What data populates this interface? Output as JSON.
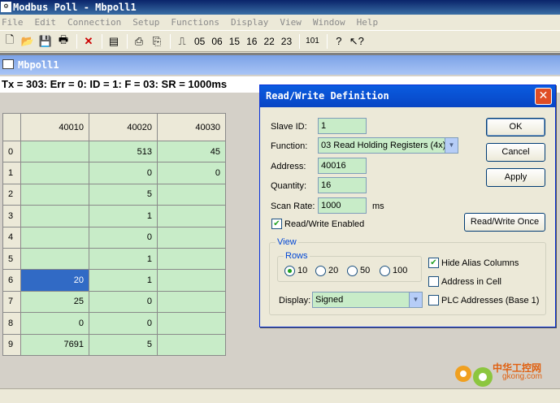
{
  "app": {
    "title": "Modbus Poll - Mbpoll1",
    "menu": [
      "File",
      "Edit",
      "Connection",
      "Setup",
      "Functions",
      "Display",
      "View",
      "Window",
      "Help"
    ],
    "toolbar_numbers": [
      "05",
      "06",
      "15",
      "16",
      "22",
      "23",
      "101"
    ]
  },
  "child": {
    "title": "Mbpoll1",
    "status": "Tx = 303: Err = 0: ID = 1: F = 03: SR = 1000ms"
  },
  "grid": {
    "columns": [
      "40010",
      "40020",
      "40030"
    ],
    "rows": [
      {
        "idx": "0",
        "c1": "",
        "c2": "513",
        "c3": "45"
      },
      {
        "idx": "1",
        "c1": "",
        "c2": "0",
        "c3": "0"
      },
      {
        "idx": "2",
        "c1": "",
        "c2": "5",
        "c3": ""
      },
      {
        "idx": "3",
        "c1": "",
        "c2": "1",
        "c3": ""
      },
      {
        "idx": "4",
        "c1": "",
        "c2": "0",
        "c3": ""
      },
      {
        "idx": "5",
        "c1": "",
        "c2": "1",
        "c3": ""
      },
      {
        "idx": "6",
        "c1": "20",
        "c2": "1",
        "c3": ""
      },
      {
        "idx": "7",
        "c1": "25",
        "c2": "0",
        "c3": ""
      },
      {
        "idx": "8",
        "c1": "0",
        "c2": "0",
        "c3": ""
      },
      {
        "idx": "9",
        "c1": "7691",
        "c2": "5",
        "c3": ""
      }
    ]
  },
  "dialog": {
    "title": "Read/Write Definition",
    "slave_id_label": "Slave ID:",
    "slave_id_value": "1",
    "function_label": "Function:",
    "function_value": "03 Read Holding Registers (4x)",
    "address_label": "Address:",
    "address_value": "40016",
    "quantity_label": "Quantity:",
    "quantity_value": "16",
    "scan_rate_label": "Scan Rate:",
    "scan_rate_value": "1000",
    "scan_rate_unit": "ms",
    "rw_enabled_label": "Read/Write Enabled",
    "ok": "OK",
    "cancel": "Cancel",
    "apply": "Apply",
    "rw_once": "Read/Write Once",
    "view_label": "View",
    "rows_label": "Rows",
    "rows_options": [
      "10",
      "20",
      "50",
      "100"
    ],
    "display_label": "Display:",
    "display_value": "Signed",
    "hide_alias": "Hide Alias Columns",
    "address_in_cell": "Address in Cell",
    "plc_addresses": "PLC Addresses (Base 1)"
  },
  "watermark": {
    "text": "中华工控网",
    "url": "gkong.com"
  }
}
